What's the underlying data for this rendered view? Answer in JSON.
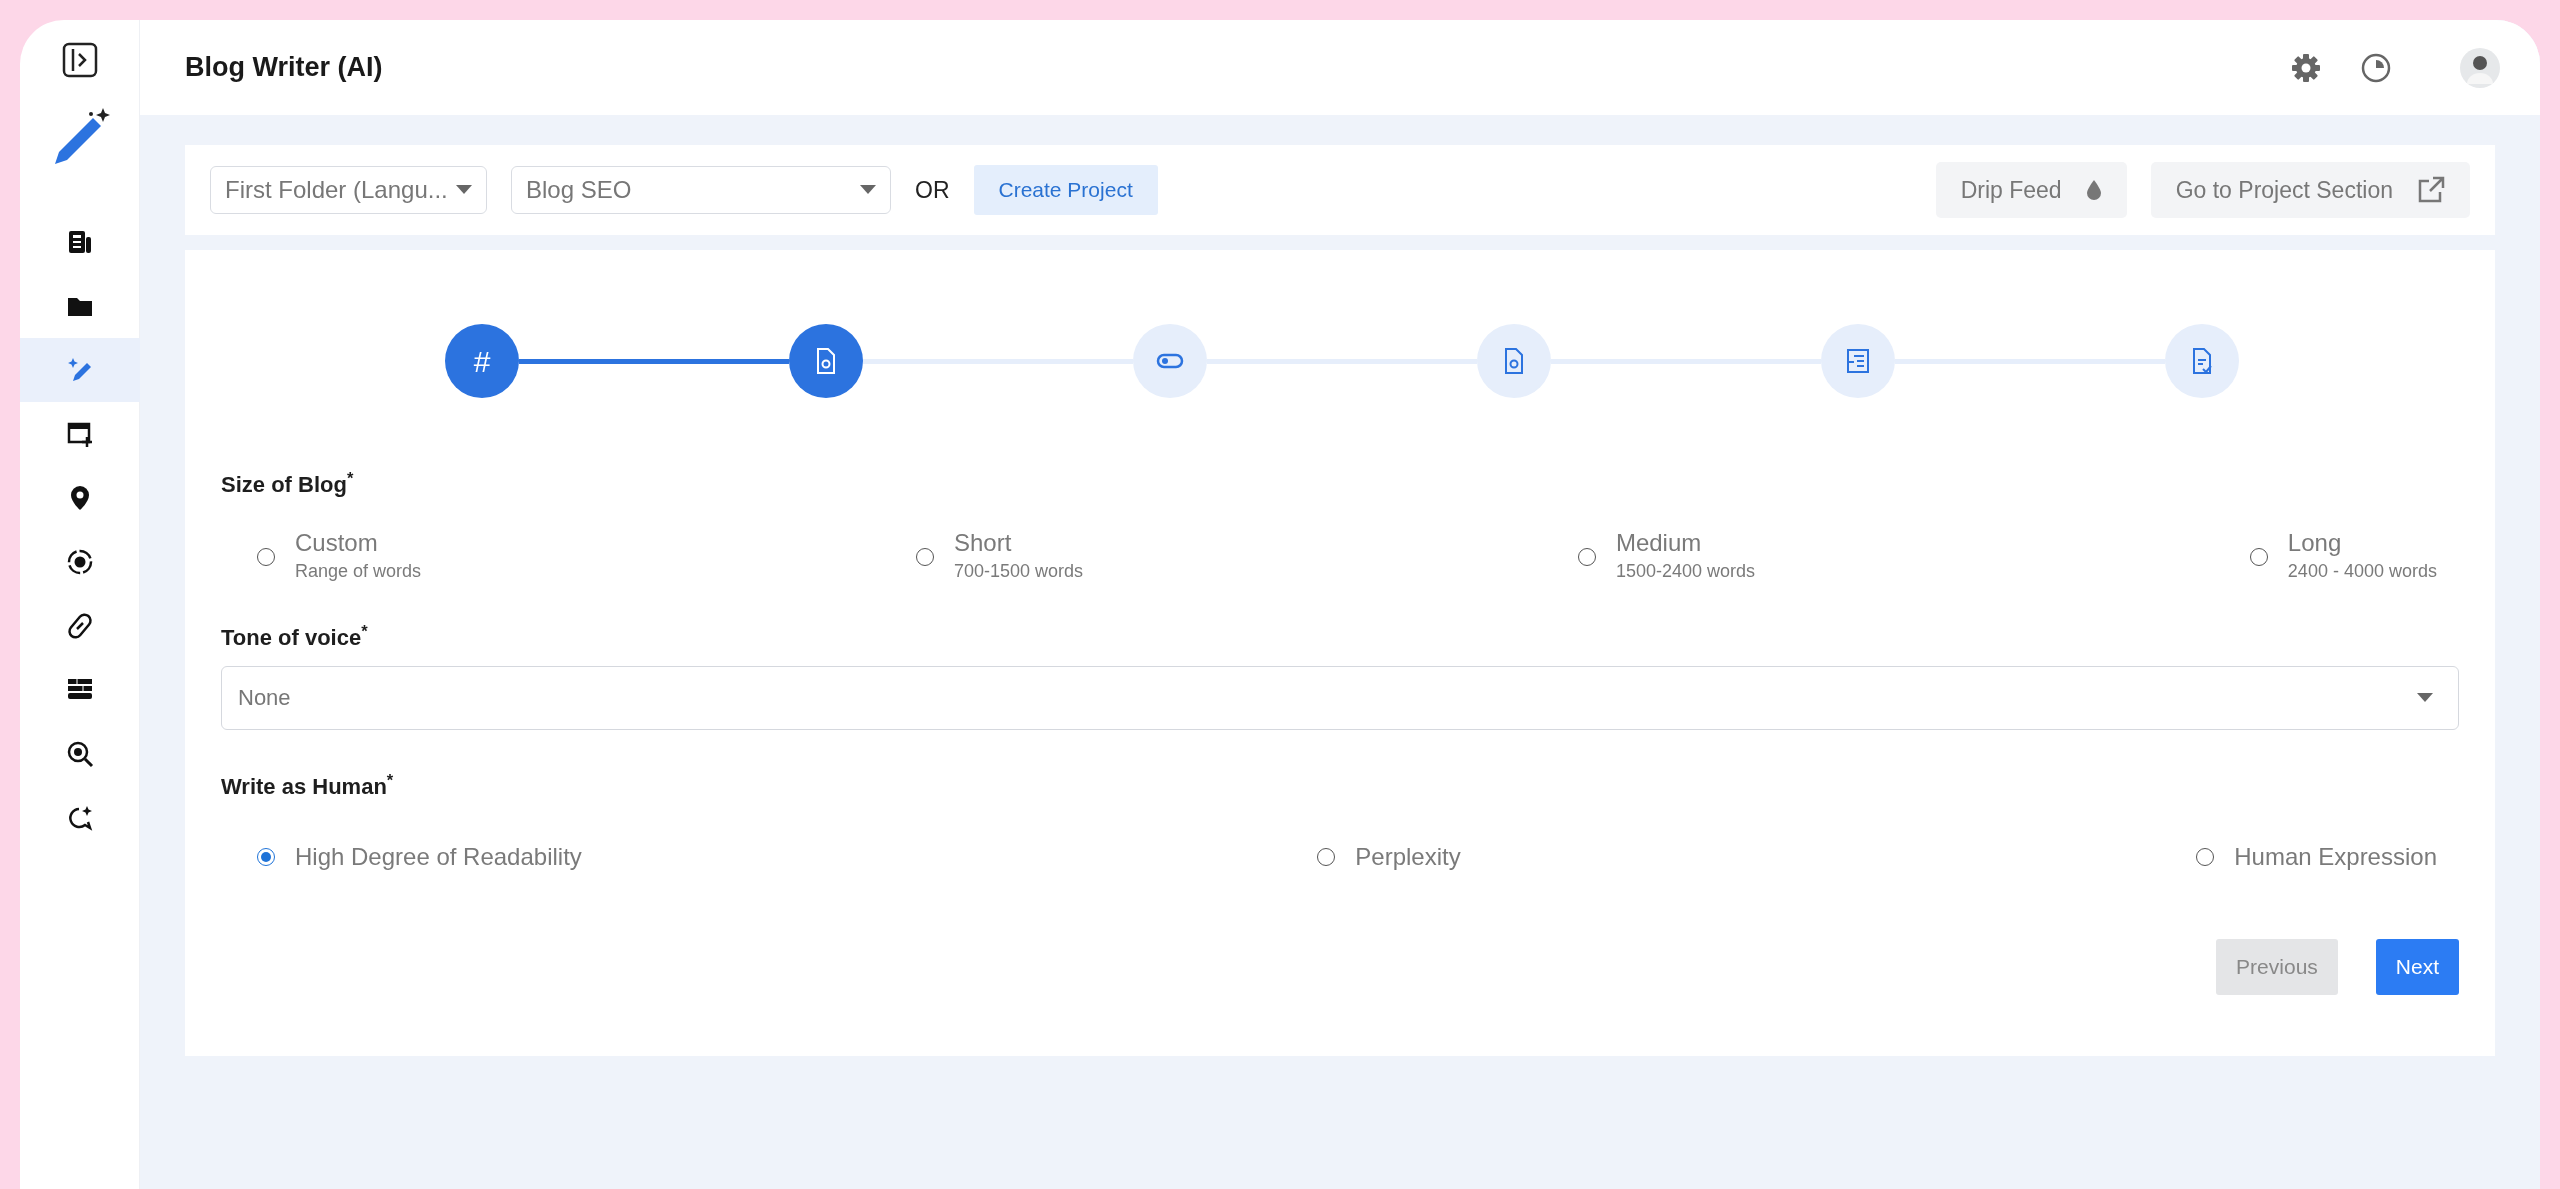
{
  "sidebar": {
    "items": [
      {
        "selected": false
      },
      {
        "selected": false
      },
      {
        "selected": true
      },
      {
        "selected": false
      },
      {
        "selected": false
      },
      {
        "selected": false
      },
      {
        "selected": false
      },
      {
        "selected": false
      },
      {
        "selected": false
      },
      {
        "selected": false
      }
    ]
  },
  "header": {
    "title": "Blog Writer (AI)"
  },
  "toolbar": {
    "folder_select": {
      "value": "First Folder (Langu..."
    },
    "type_select": {
      "value": "Blog SEO"
    },
    "or_text": "OR",
    "create_button": "Create Project",
    "drip_button": "Drip Feed",
    "project_button": "Go to Project Section"
  },
  "stepper": {
    "steps": [
      {
        "label": "#",
        "done": true
      },
      {
        "done": true
      },
      {
        "done": false
      },
      {
        "done": false
      },
      {
        "done": false
      },
      {
        "done": false
      }
    ]
  },
  "form": {
    "size": {
      "label": "Size of Blog$^{*}$",
      "options": [
        {
          "label": "Custom",
          "hint": "Range of words",
          "selected": false
        },
        {
          "label": "Short",
          "hint": "700-1500 words",
          "selected": false
        },
        {
          "label": "Medium",
          "hint": "1500-2400 words",
          "selected": false
        },
        {
          "label": "Long",
          "hint": "2400 - 4000 words",
          "selected": false
        }
      ]
    },
    "tone": {
      "label": "Tone of voice$^{*}$",
      "value": "None"
    },
    "human": {
      "label": "Write as Human$^{*}$",
      "options": [
        {
          "label": "High Degree of Readability",
          "selected": true
        },
        {
          "label": "Perplexity",
          "selected": false
        },
        {
          "label": "Human Expression",
          "selected": false
        }
      ]
    },
    "buttons": [
      {
        "label": "Previous",
        "disabled": true
      },
      {
        "label": "Next",
        "disabled": false
      }
    ]
  }
}
